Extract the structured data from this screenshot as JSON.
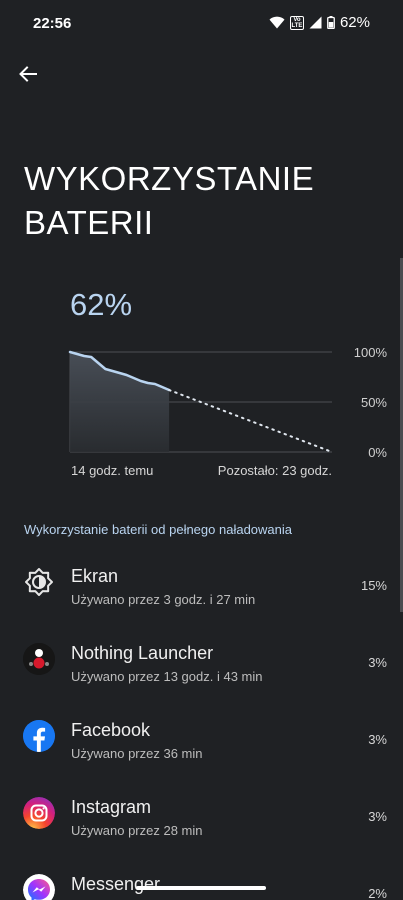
{
  "status_bar": {
    "time": "22:56",
    "volte_top": "Vo",
    "volte_bottom": "LTE",
    "battery_percent": "62%"
  },
  "header": {
    "back_icon": "arrow-left-icon",
    "title": "WYKORZYSTANIE BATERII"
  },
  "chart": {
    "current_percent": "62%",
    "footer_left": "14 godz. temu",
    "footer_right": "Pozostało: 23 godz."
  },
  "chart_data": {
    "type": "line",
    "ylim": [
      0,
      100
    ],
    "y_tick_labels": [
      "100%",
      "50%",
      "0%"
    ],
    "series": [
      {
        "style": "solid",
        "x_hours": [
          0,
          1,
          2,
          3,
          4,
          5,
          6,
          7,
          8,
          9,
          10,
          11,
          12,
          13,
          14
        ],
        "values": [
          100,
          98,
          96,
          95,
          89,
          83,
          81,
          79,
          77,
          74,
          71,
          69,
          68,
          65,
          62
        ]
      },
      {
        "style": "dotted",
        "x_hours": [
          14,
          37
        ],
        "values": [
          62,
          0
        ]
      }
    ]
  },
  "section": {
    "header": "Wykorzystanie baterii od pełnego naładowania"
  },
  "apps": [
    {
      "icon": "brightness-icon",
      "name": "Ekran",
      "usage": "Używano przez 3 godz. i 27 min",
      "percent": "15%"
    },
    {
      "icon": "nothing-launcher-icon",
      "name": "Nothing Launcher",
      "usage": "Używano przez 13 godz. i 43 min",
      "percent": "3%"
    },
    {
      "icon": "facebook-icon",
      "name": "Facebook",
      "usage": "Używano przez 36 min",
      "percent": "3%"
    },
    {
      "icon": "instagram-icon",
      "name": "Instagram",
      "usage": "Używano przez 28 min",
      "percent": "3%"
    },
    {
      "icon": "messenger-icon",
      "name": "Messenger",
      "usage": "",
      "percent": "2%"
    }
  ],
  "colors": {
    "background": "#1f2124",
    "accent": "#b9d4f0",
    "facebook": "#1877f2"
  }
}
